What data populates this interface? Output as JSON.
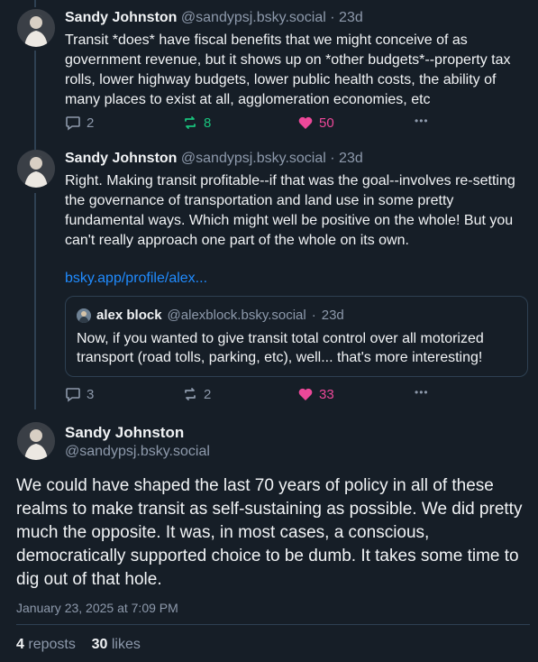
{
  "posts": [
    {
      "author": "Sandy Johnston",
      "handle": "@sandypsj.bsky.social",
      "time": "23d",
      "text": "Transit *does* have fiscal benefits that we might conceive of as government revenue, but it shows up on *other budgets*--property tax rolls, lower highway budgets, lower public health costs, the ability of many places to exist at all, agglomeration economies, etc",
      "replies": "2",
      "reposts": "8",
      "likes": "50",
      "more": "•••"
    },
    {
      "author": "Sandy Johnston",
      "handle": "@sandypsj.bsky.social",
      "time": "23d",
      "text": "Right. Making transit profitable--if that was the goal--involves re-setting the governance of transportation and land use in some pretty fundamental ways. Which might well be positive on the whole! But you can't really approach one part of the whole on its own.",
      "link": "bsky.app/profile/alex...",
      "quote": {
        "author": "alex block",
        "handle": "@alexblock.bsky.social",
        "time": "23d",
        "text": "Now, if you wanted to give transit total control over all motorized transport (road tolls, parking, etc), well... that's more interesting!"
      },
      "replies": "3",
      "reposts": "2",
      "likes": "33",
      "more": "•••"
    }
  ],
  "main_post": {
    "author": "Sandy Johnston",
    "handle": "@sandypsj.bsky.social",
    "text": "We could have shaped the last 70 years of policy in all of these realms to make transit as self-sustaining as possible. We did pretty much the opposite. It was, in most cases, a conscious, democratically supported choice to be dumb. It takes some time to dig out of that hole.",
    "timestamp": "January 23, 2025 at 7:09 PM",
    "repost_count": "4",
    "repost_label": "reposts",
    "like_count": "30",
    "like_label": "likes"
  },
  "dot_separator": "·",
  "colors": {
    "background": "#161e27",
    "link": "#208bfe",
    "repost_active": "#19c37d",
    "like_active": "#ec4899",
    "muted": "#8d99ab"
  }
}
